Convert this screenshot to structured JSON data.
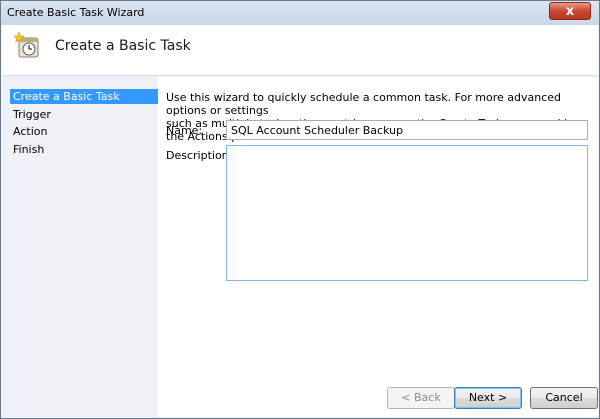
{
  "window": {
    "title": "Create Basic Task Wizard",
    "close_label": "x"
  },
  "header": {
    "title": "Create a Basic Task"
  },
  "steps": [
    {
      "label": "Create a Basic Task",
      "selected": true
    },
    {
      "label": "Trigger",
      "selected": false
    },
    {
      "label": "Action",
      "selected": false
    },
    {
      "label": "Finish",
      "selected": false
    }
  ],
  "main": {
    "intro_line1": "Use this wizard to quickly schedule a common task.  For more advanced options or settings",
    "intro_line2": "such as multiple task actions or triggers, use the Create Task command in the Actions pane.",
    "name_label": "Name:",
    "name_value": "SQL Account Scheduler Backup",
    "description_label": "Description:",
    "description_value": ""
  },
  "buttons": {
    "back": "< Back",
    "next": "Next >",
    "cancel": "Cancel"
  },
  "colors": {
    "selection": "#3399ff",
    "close": "#c8452e"
  },
  "icons": {
    "header": "task-scheduler-clock-icon"
  }
}
